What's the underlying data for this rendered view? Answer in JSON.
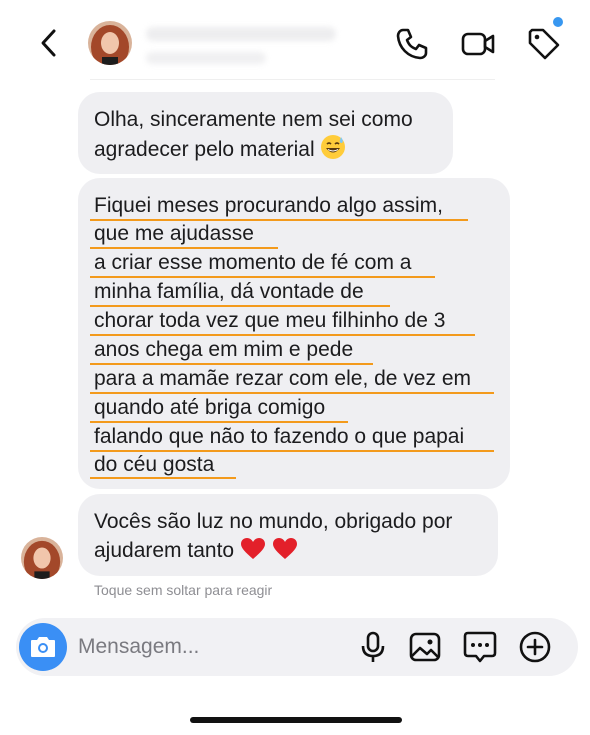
{
  "header": {
    "back_label": "back",
    "icons": [
      "chevron-left-icon",
      "phone-icon",
      "video-camera-icon",
      "tag-icon"
    ],
    "notification_dot_color": "#3897f0"
  },
  "messages": [
    {
      "lines": [
        "Olha, sinceramente nem sei como",
        "agradecer pelo material"
      ],
      "emoji": "sweat-smile-emoji"
    },
    {
      "lines": [
        "Fiquei meses procurando algo assim,",
        "que me ajudasse",
        "a criar esse momento de fé com a",
        "minha família, dá vontade de",
        "chorar toda vez que meu filhinho de 3",
        "anos chega em mim e pede",
        "para a mamãe rezar com ele, de vez em",
        "quando até briga comigo",
        "falando que não to fazendo o que papai",
        "do céu gosta"
      ],
      "underline_color": "#f39a1c"
    },
    {
      "lines": [
        "Vocês são luz no mundo, obrigado por",
        "ajudarem tanto"
      ],
      "emoji": "red-heart-emoji x2"
    }
  ],
  "hint": "Toque sem soltar para reagir",
  "composer": {
    "placeholder": "Mensagem...",
    "camera_color": "#3a8ff5",
    "icons": [
      "camera-icon",
      "microphone-icon",
      "gallery-icon",
      "sticker-icon",
      "plus-circle-icon"
    ]
  }
}
